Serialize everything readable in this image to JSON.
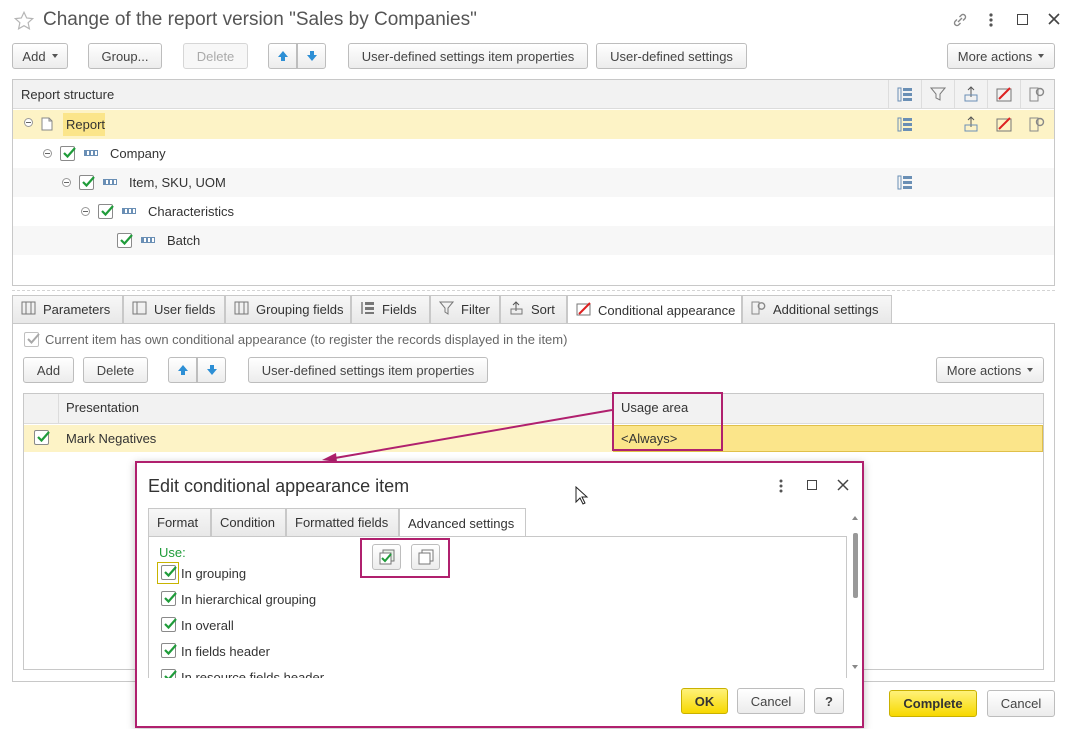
{
  "window": {
    "title": "Change of the report version \"Sales by Companies\""
  },
  "toolbar": {
    "add": "Add",
    "group": "Group...",
    "delete": "Delete",
    "item_properties": "User-defined settings item properties",
    "user_settings": "User-defined settings",
    "more_actions": "More actions"
  },
  "structure": {
    "header": "Report structure",
    "items": [
      {
        "label": "Report"
      },
      {
        "label": "Company"
      },
      {
        "label": "Item, SKU, UOM"
      },
      {
        "label": "Characteristics"
      },
      {
        "label": "Batch"
      }
    ]
  },
  "tabs": [
    {
      "label": "Parameters",
      "icon": "parameters-icon"
    },
    {
      "label": "User fields",
      "icon": "user-fields-icon"
    },
    {
      "label": "Grouping fields",
      "icon": "grouping-fields-icon"
    },
    {
      "label": "Fields",
      "icon": "fields-icon"
    },
    {
      "label": "Filter",
      "icon": "filter-icon"
    },
    {
      "label": "Sort",
      "icon": "sort-icon"
    },
    {
      "label": "Conditional appearance",
      "icon": "conditional-appearance-icon"
    },
    {
      "label": "Additional settings",
      "icon": "additional-settings-icon"
    }
  ],
  "appearance": {
    "own_label": "Current item has own conditional appearance (to register the records displayed in the item)",
    "add": "Add",
    "delete": "Delete",
    "item_properties": "User-defined settings item properties",
    "more_actions": "More actions",
    "col_presentation": "Presentation",
    "col_usage": "Usage area",
    "rows": [
      {
        "presentation": "Mark Negatives",
        "usage": "<Always>"
      }
    ]
  },
  "footer": {
    "complete": "Complete",
    "cancel": "Cancel"
  },
  "dialog": {
    "title": "Edit conditional appearance item",
    "tabs": [
      "Format",
      "Condition",
      "Formatted fields",
      "Advanced settings"
    ],
    "use_label": "Use:",
    "options": [
      {
        "label": "In grouping",
        "checked": true
      },
      {
        "label": "In hierarchical grouping",
        "checked": true
      },
      {
        "label": "In overall",
        "checked": true
      },
      {
        "label": "In fields header",
        "checked": true
      },
      {
        "label": "In resource fields header",
        "checked": true
      }
    ],
    "ok": "OK",
    "cancel": "Cancel",
    "help": "?"
  },
  "colors": {
    "highlight_row": "#fdf3c6",
    "selected_cell": "#fbe58a",
    "annotation": "#b0206e",
    "accent_green": "#1f9c3a"
  }
}
